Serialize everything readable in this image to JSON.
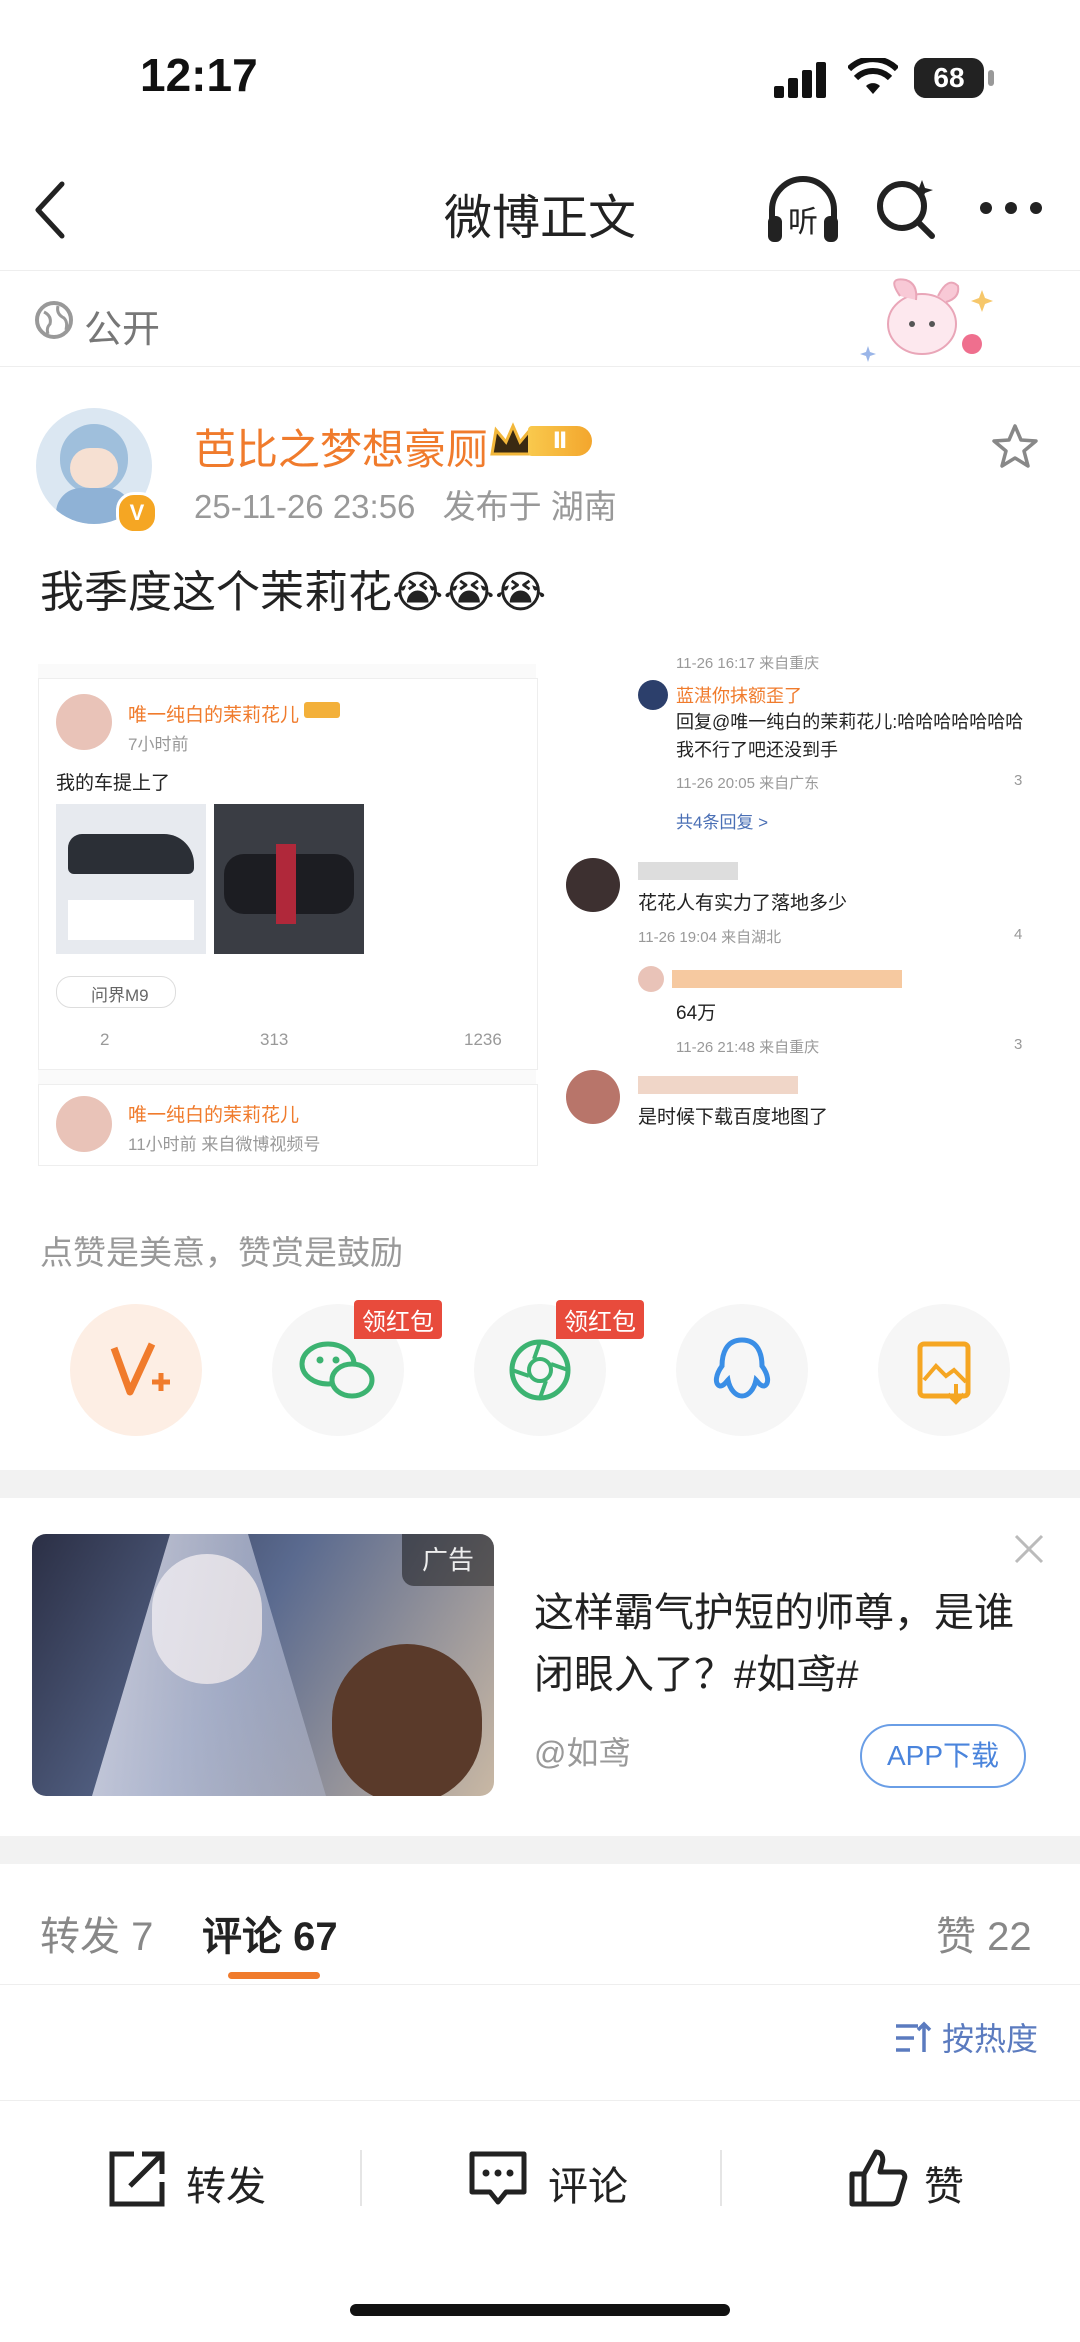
{
  "status": {
    "time": "12:17",
    "battery": "68"
  },
  "nav": {
    "title": "微博正文"
  },
  "visibility": {
    "label": "公开"
  },
  "post": {
    "username": "芭比之梦想豪厕",
    "rank_badge": "Ⅱ",
    "time": "25-11-26 23:56",
    "location": "发布于 湖南",
    "text": "我季度这个茉莉花",
    "emoji": "😭😭😭"
  },
  "screenshot": {
    "left": {
      "user": "唯一纯白的茉莉花儿",
      "time": "7小时前",
      "text": "我的车提上了",
      "car_tag": "问界M9",
      "reposts": "2",
      "comments": "313",
      "likes": "1236",
      "user2": "唯一纯白的茉莉花儿",
      "time2": "11小时前  来自微博视频号"
    },
    "right": {
      "top_meta": "11-26 16:17 来自重庆",
      "reply1_user": "蓝湛你抹额歪了",
      "reply1_text": "回复@唯一纯白的茉莉花儿:哈哈哈哈哈哈哈我不行了吧还没到手",
      "reply1_meta": "11-26 20:05 来自广东",
      "reply1_likes": "3",
      "more_replies": "共4条回复 >",
      "c2_text": "花花人有实力了落地多少",
      "c2_meta": "11-26 19:04 来自湖北",
      "c2_likes": "4",
      "c2_reply_text": "64万",
      "c2_reply_meta": "11-26 21:48 来自重庆",
      "c2_reply_likes": "3",
      "c3_text": "是时候下载百度地图了"
    }
  },
  "tip": "点赞是美意，赞赏是鼓励",
  "share": {
    "red_tag": "领红包"
  },
  "ad": {
    "tag": "广告",
    "title": "这样霸气护短的师尊，是谁闭眼入了？#如鸢#",
    "source": "@如鸢",
    "button": "APP下载"
  },
  "tabs": {
    "repost": "转发 7",
    "comment": "评论 67",
    "like": "赞 22"
  },
  "sort": {
    "label": "按热度"
  },
  "bottom": {
    "repost": "转发",
    "comment": "评论",
    "like": "赞"
  },
  "colors": {
    "accent": "#f07b2c",
    "link": "#4a84dc",
    "red": "#e84b3c"
  }
}
